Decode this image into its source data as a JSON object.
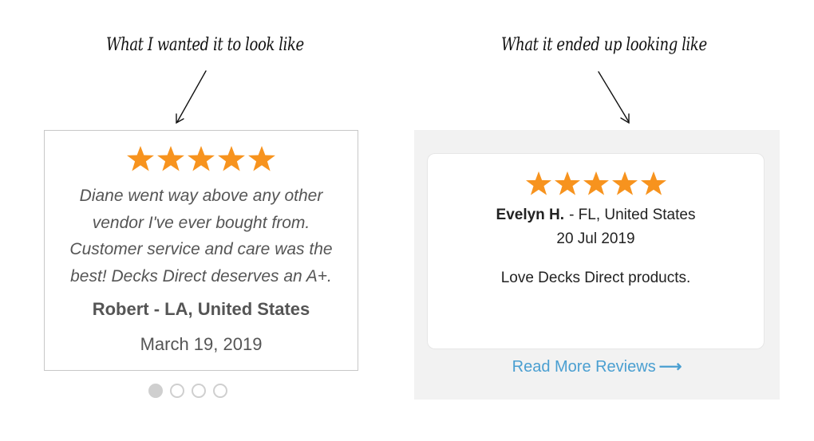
{
  "captions": {
    "left": "What I wanted it to look like",
    "right": "What it ended up looking like"
  },
  "colors": {
    "star": "#f7931e",
    "link": "#4a9fd1",
    "panel_bg": "#f2f2f2"
  },
  "left_card": {
    "rating": 5,
    "quote": "Diane went way above any other vendor I've ever bought from. Customer service and care was the best! Decks Direct deserves an A+.",
    "author": "Robert - LA, United States",
    "date": "March 19, 2019",
    "carousel": {
      "total": 4,
      "active": 1
    }
  },
  "right_card": {
    "rating": 5,
    "reviewer_name": "Evelyn H.",
    "reviewer_location": "- FL, United States",
    "date": "20 Jul 2019",
    "text": "Love Decks Direct products.",
    "read_more_label": "Read More Reviews",
    "read_more_icon": "arrow-right-icon"
  }
}
